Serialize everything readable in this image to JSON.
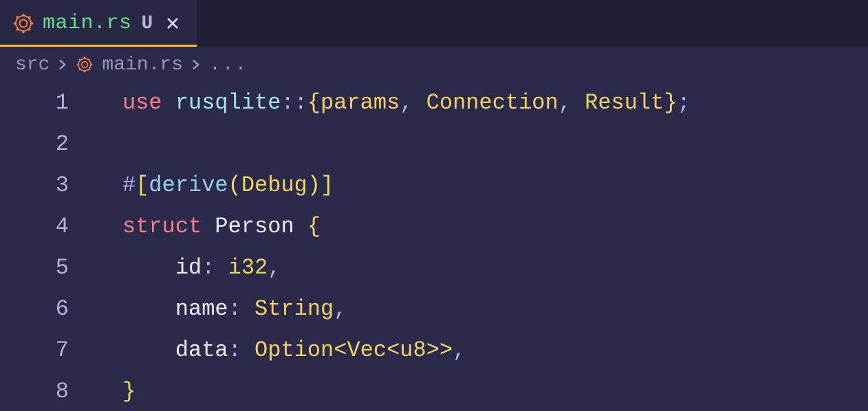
{
  "tab": {
    "filename": "main.rs",
    "modified_flag": "U",
    "icon": "rust-icon"
  },
  "breadcrumb": {
    "segments": [
      "src",
      "main.rs",
      "..."
    ],
    "icon": "rust-icon"
  },
  "editor": {
    "line_numbers": [
      "1",
      "2",
      "3",
      "4",
      "5",
      "6",
      "7",
      "8"
    ],
    "tokens": [
      [
        {
          "t": "use ",
          "c": "kw"
        },
        {
          "t": "rusqlite",
          "c": "mod"
        },
        {
          "t": "::",
          "c": "colc"
        },
        {
          "t": "{",
          "c": "br"
        },
        {
          "t": "params",
          "c": "ty"
        },
        {
          "t": ", ",
          "c": "pu"
        },
        {
          "t": "Connection",
          "c": "ty"
        },
        {
          "t": ", ",
          "c": "pu"
        },
        {
          "t": "Result",
          "c": "ty"
        },
        {
          "t": "}",
          "c": "br"
        },
        {
          "t": ";",
          "c": "pu"
        }
      ],
      [],
      [
        {
          "t": "#",
          "c": "pu"
        },
        {
          "t": "[",
          "c": "br"
        },
        {
          "t": "derive",
          "c": "fn"
        },
        {
          "t": "(",
          "c": "br"
        },
        {
          "t": "Debug",
          "c": "ty"
        },
        {
          "t": ")",
          "c": "br"
        },
        {
          "t": "]",
          "c": "br"
        }
      ],
      [
        {
          "t": "struct ",
          "c": "kw"
        },
        {
          "t": "Person ",
          "c": "tyname"
        },
        {
          "t": "{",
          "c": "br"
        }
      ],
      [
        {
          "t": "    ",
          "c": "id"
        },
        {
          "t": "id",
          "c": "id"
        },
        {
          "t": ": ",
          "c": "pu"
        },
        {
          "t": "i32",
          "c": "ty"
        },
        {
          "t": ",",
          "c": "pu"
        }
      ],
      [
        {
          "t": "    ",
          "c": "id"
        },
        {
          "t": "name",
          "c": "id"
        },
        {
          "t": ": ",
          "c": "pu"
        },
        {
          "t": "String",
          "c": "ty"
        },
        {
          "t": ",",
          "c": "pu"
        }
      ],
      [
        {
          "t": "    ",
          "c": "id"
        },
        {
          "t": "data",
          "c": "id"
        },
        {
          "t": ": ",
          "c": "pu"
        },
        {
          "t": "Option",
          "c": "ty"
        },
        {
          "t": "<",
          "c": "br"
        },
        {
          "t": "Vec",
          "c": "ty"
        },
        {
          "t": "<",
          "c": "br"
        },
        {
          "t": "u8",
          "c": "ty"
        },
        {
          "t": ">>",
          "c": "br"
        },
        {
          "t": ",",
          "c": "pu"
        }
      ],
      [
        {
          "t": "}",
          "c": "br"
        }
      ]
    ]
  }
}
